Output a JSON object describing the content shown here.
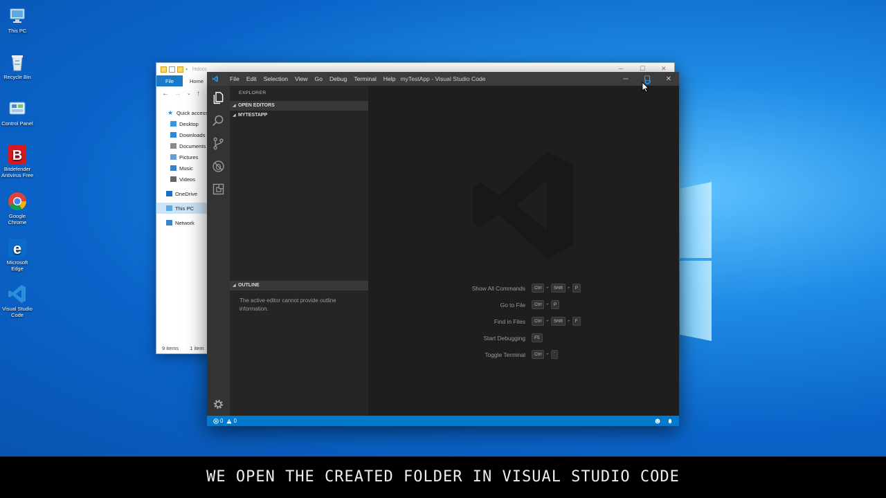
{
  "desktop": {
    "icons": [
      {
        "label": "This PC",
        "icon": "this-pc-icon"
      },
      {
        "label": "Recycle Bin",
        "icon": "recycle-bin-icon"
      },
      {
        "label": "Control Panel",
        "icon": "control-panel-icon"
      },
      {
        "label": "Bitdefender Antivirus Free",
        "icon": "bitdefender-icon"
      },
      {
        "label": "Google Chrome",
        "icon": "chrome-icon"
      },
      {
        "label": "Microsoft Edge",
        "icon": "edge-icon"
      },
      {
        "label": "Visual Studio Code",
        "icon": "vscode-icon"
      }
    ]
  },
  "file_explorer": {
    "title": "htdocs",
    "ribbon": {
      "file_tab": "File",
      "home_tab": "Home"
    },
    "nav_items": [
      {
        "label": "Quick access",
        "icon": "star-icon"
      },
      {
        "label": "Desktop",
        "icon": "desktop-folder-icon"
      },
      {
        "label": "Downloads",
        "icon": "downloads-icon"
      },
      {
        "label": "Documents",
        "icon": "documents-icon"
      },
      {
        "label": "Pictures",
        "icon": "pictures-icon"
      },
      {
        "label": "Music",
        "icon": "music-icon"
      },
      {
        "label": "Videos",
        "icon": "videos-icon"
      },
      {
        "label": "OneDrive",
        "icon": "onedrive-icon"
      },
      {
        "label": "This PC",
        "icon": "this-pc-icon"
      },
      {
        "label": "Network",
        "icon": "network-icon"
      }
    ],
    "status": {
      "items": "9 items",
      "selected": "1 item"
    }
  },
  "vscode": {
    "menu": [
      "File",
      "Edit",
      "Selection",
      "View",
      "Go",
      "Debug",
      "Terminal",
      "Help"
    ],
    "window_title": "myTestApp - Visual Studio Code",
    "sidebar": {
      "title": "EXPLORER",
      "open_editors": "OPEN EDITORS",
      "folder": "MYTESTAPP",
      "outline": "OUTLINE",
      "outline_message": "The active editor cannot provide outline information."
    },
    "shortcuts": [
      {
        "label": "Show All Commands",
        "keys": [
          "Ctrl",
          "Shift",
          "P"
        ]
      },
      {
        "label": "Go to File",
        "keys": [
          "Ctrl",
          "P"
        ]
      },
      {
        "label": "Find in Files",
        "keys": [
          "Ctrl",
          "Shift",
          "F"
        ]
      },
      {
        "label": "Start Debugging",
        "keys": [
          "F5"
        ]
      },
      {
        "label": "Toggle Terminal",
        "keys": [
          "Ctrl",
          "`"
        ]
      }
    ],
    "status_bar": {
      "errors": "0",
      "warnings": "0"
    },
    "accent_color": "#007acc"
  },
  "caption": "WE OPEN THE CREATED FOLDER IN VISUAL STUDIO CODE"
}
